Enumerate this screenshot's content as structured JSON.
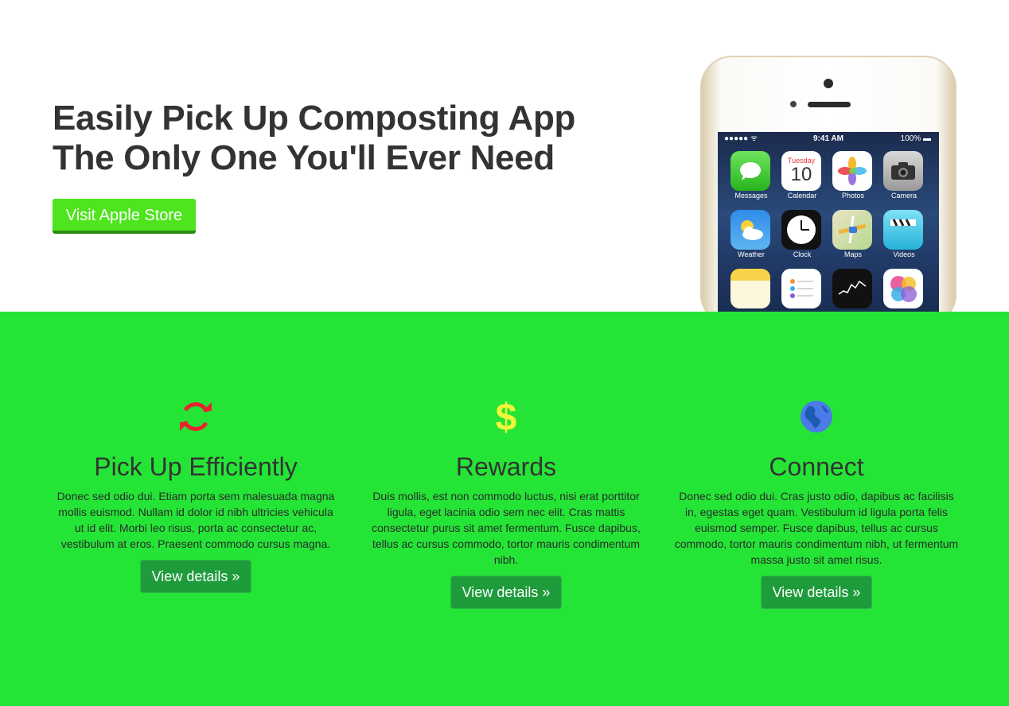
{
  "hero": {
    "title_line1": "Easily Pick Up Composting App",
    "title_line2": "The Only One You'll Ever Need",
    "cta_label": "Visit Apple Store",
    "accent_color": "#4ee51f"
  },
  "phone": {
    "status_signal": "●●●●● ᯤ",
    "status_time": "9:41 AM",
    "status_battery": "100% ▬",
    "apps": [
      {
        "label": "Messages",
        "icon": "messages-icon"
      },
      {
        "label": "Calendar",
        "icon": "calendar-icon",
        "day": "Tuesday",
        "date": "10"
      },
      {
        "label": "Photos",
        "icon": "photos-icon"
      },
      {
        "label": "Camera",
        "icon": "camera-icon"
      },
      {
        "label": "Weather",
        "icon": "weather-icon"
      },
      {
        "label": "Clock",
        "icon": "clock-icon"
      },
      {
        "label": "Maps",
        "icon": "maps-icon"
      },
      {
        "label": "Videos",
        "icon": "videos-icon"
      },
      {
        "label": "",
        "icon": "notes-icon"
      },
      {
        "label": "",
        "icon": "reminders-icon"
      },
      {
        "label": "",
        "icon": "stocks-icon"
      },
      {
        "label": "",
        "icon": "game-center-icon"
      }
    ]
  },
  "features": {
    "background_color": "#24e536",
    "items": [
      {
        "icon": "refresh-icon",
        "icon_color": "#e8232f",
        "title": "Pick Up Efficiently",
        "text": "Donec sed odio dui. Etiam porta sem malesuada magna mollis euismod. Nullam id dolor id nibh ultricies vehicula ut id elit. Morbi leo risus, porta ac consectetur ac, vestibulum at eros. Praesent commodo cursus magna.",
        "button_label": "View details »"
      },
      {
        "icon": "dollar-icon",
        "icon_color": "#f1f53a",
        "icon_glyph": "$",
        "title": "Rewards",
        "text": "Duis mollis, est non commodo luctus, nisi erat porttitor ligula, eget lacinia odio sem nec elit. Cras mattis consectetur purus sit amet fermentum. Fusce dapibus, tellus ac cursus commodo, tortor mauris condimentum nibh.",
        "button_label": "View details »"
      },
      {
        "icon": "globe-icon",
        "icon_color": "#4a7be8",
        "title": "Connect",
        "text": "Donec sed odio dui. Cras justo odio, dapibus ac facilisis in, egestas eget quam. Vestibulum id ligula porta felis euismod semper. Fusce dapibus, tellus ac cursus commodo, tortor mauris condimentum nibh, ut fermentum massa justo sit amet risus.",
        "button_label": "View details »"
      }
    ]
  }
}
